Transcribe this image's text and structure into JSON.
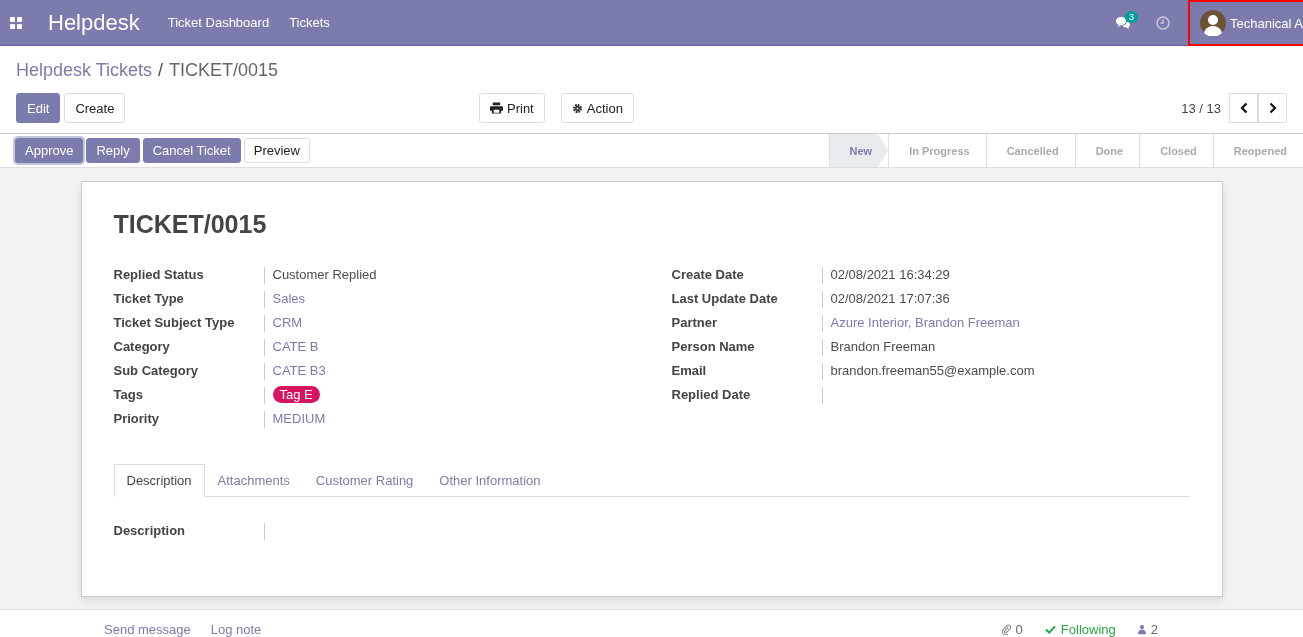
{
  "navbar": {
    "app_title": "Helpdesk",
    "menu": [
      "Ticket Dashboard",
      "Tickets"
    ],
    "message_count": "3",
    "user": "Techanical A"
  },
  "breadcrumb": {
    "parent": "Helpdesk Tickets",
    "separator": "/",
    "current": "TICKET/0015"
  },
  "control_panel": {
    "buttons": [
      {
        "label": "Edit",
        "kind": "primary"
      },
      {
        "label": "Create",
        "kind": "secondary"
      }
    ],
    "print": "Print",
    "action": "Action",
    "pager": "13 / 13"
  },
  "header_buttons": [
    {
      "label": "Approve",
      "kind": "primary",
      "focused": true
    },
    {
      "label": "Reply",
      "kind": "primary",
      "focused": false
    },
    {
      "label": "Cancel Ticket",
      "kind": "primary",
      "focused": false
    },
    {
      "label": "Preview",
      "kind": "secondary",
      "focused": false
    }
  ],
  "stages": [
    {
      "label": "New",
      "selected": true
    },
    {
      "label": "In Progress",
      "selected": false
    },
    {
      "label": "Cancelled",
      "selected": false
    },
    {
      "label": "Done",
      "selected": false
    },
    {
      "label": "Closed",
      "selected": false
    },
    {
      "label": "Reopened",
      "selected": false
    }
  ],
  "ticket": {
    "title": "TICKET/0015",
    "left_fields": [
      {
        "label": "Replied Status",
        "value": "Customer Replied",
        "kind": "text"
      },
      {
        "label": "Ticket Type",
        "value": "Sales",
        "kind": "link"
      },
      {
        "label": "Ticket Subject Type",
        "value": "CRM",
        "kind": "link"
      },
      {
        "label": "Category",
        "value": "CATE B",
        "kind": "link"
      },
      {
        "label": "Sub Category",
        "value": "CATE B3",
        "kind": "link"
      },
      {
        "label": "Tags",
        "value": "Tag E",
        "kind": "tag",
        "color": "#d6145f"
      },
      {
        "label": "Priority",
        "value": "MEDIUM",
        "kind": "link"
      }
    ],
    "right_fields": [
      {
        "label": "Create Date",
        "value": "02/08/2021 16:34:29",
        "kind": "text"
      },
      {
        "label": "Last Update Date",
        "value": "02/08/2021 17:07:36",
        "kind": "text"
      },
      {
        "label": "Partner",
        "value": "Azure Interior, Brandon Freeman",
        "kind": "link"
      },
      {
        "label": "Person Name",
        "value": "Brandon Freeman",
        "kind": "text"
      },
      {
        "label": "Email",
        "value": "brandon.freeman55@example.com",
        "kind": "text"
      },
      {
        "label": "Replied Date",
        "kind": "empty"
      }
    ],
    "tabs": [
      {
        "label": "Description",
        "selected": true
      },
      {
        "label": "Attachments",
        "selected": false
      },
      {
        "label": "Customer Rating",
        "selected": false
      },
      {
        "label": "Other Information",
        "selected": false
      }
    ],
    "description_label": "Description"
  },
  "chatter": {
    "send_message": "Send message",
    "log_note": "Log note",
    "attachments": "0",
    "following": "Following",
    "followers": "2"
  }
}
